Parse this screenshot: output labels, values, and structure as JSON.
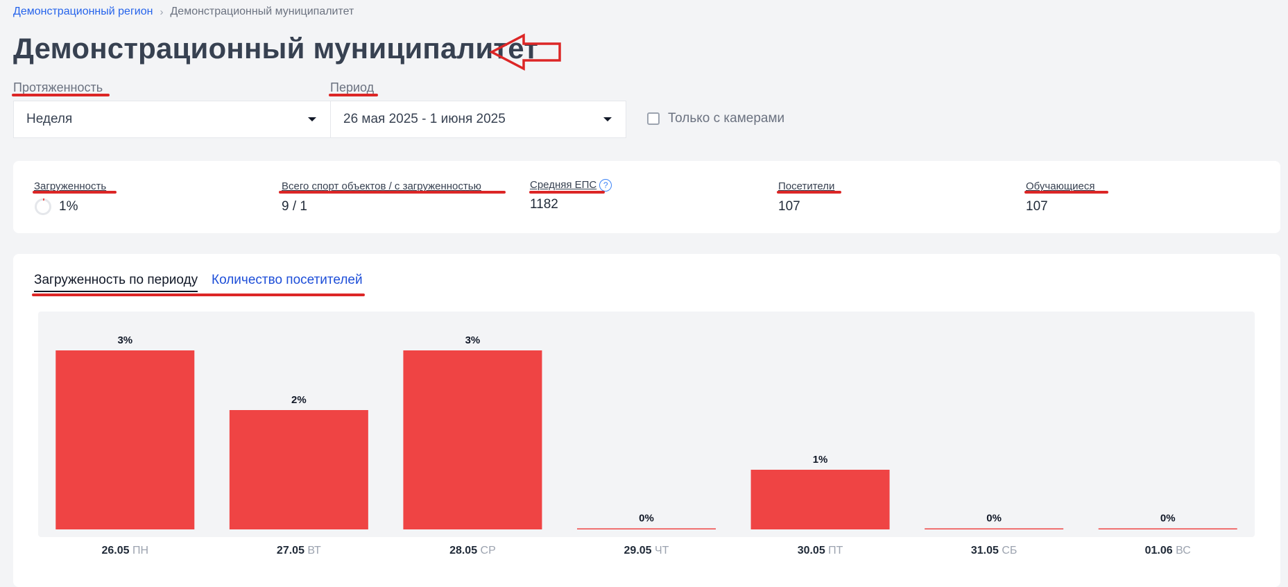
{
  "breadcrumb": {
    "region": "Демонстрационный регион",
    "separator": "›",
    "current": "Демонстрационный муниципалитет"
  },
  "page": {
    "title": "Демонстрационный муниципалитет"
  },
  "filters": {
    "length_label": "Протяженность",
    "length_value": "Неделя",
    "period_label": "Период",
    "period_value": "26 мая 2025 - 1 июня 2025",
    "camera_only_label": "Только с камерами",
    "camera_only_checked": false
  },
  "stats": {
    "load_label": "Загруженность",
    "load_value": "1%",
    "objects_label": "Всего спорт объектов / с загруженностью",
    "objects_value": "9 / 1",
    "eps_label": "Средняя ЕПС",
    "eps_help": "?",
    "eps_value": "1182",
    "visitors_label": "Посетители",
    "visitors_value": "107",
    "students_label": "Обучающиеся",
    "students_value": "107"
  },
  "tabs": {
    "load_by_period": "Загруженность по периоду",
    "visitors_count": "Количество посетителей"
  },
  "colors": {
    "bar": "#ef4444",
    "annotation": "#dc2626",
    "link": "#2563eb"
  },
  "chart_data": {
    "type": "bar",
    "categories": [
      "26.05",
      "27.05",
      "28.05",
      "29.05",
      "30.05",
      "31.05",
      "01.06"
    ],
    "day_labels": [
      "ПН",
      "ВТ",
      "СР",
      "ЧТ",
      "ПТ",
      "СБ",
      "ВС"
    ],
    "values": [
      3,
      2,
      3,
      0,
      1,
      0,
      0
    ],
    "value_labels": [
      "3%",
      "2%",
      "3%",
      "0%",
      "1%",
      "0%",
      "0%"
    ],
    "ylim": [
      0,
      3
    ],
    "grid": false,
    "legend": "none"
  }
}
